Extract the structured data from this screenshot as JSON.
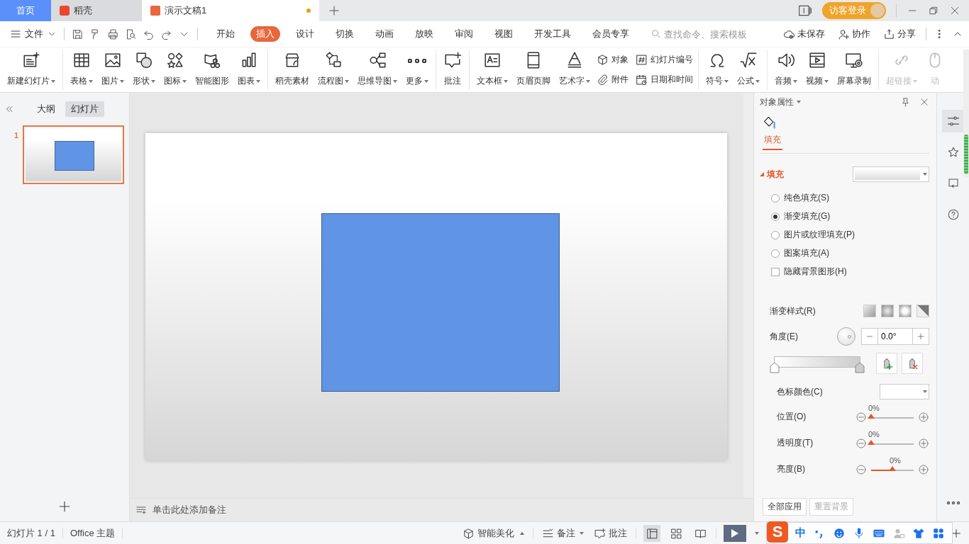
{
  "title_bar": {
    "tabs": [
      {
        "label": "首页",
        "kind": "home",
        "selected": false
      },
      {
        "label": "稻壳",
        "kind": "app",
        "selected": false
      },
      {
        "label": "演示文稿1",
        "kind": "doc",
        "selected": true,
        "unsaved": true
      }
    ],
    "login_button": "访客登录"
  },
  "menu_bar": {
    "file_menu": "文件",
    "tabs": [
      {
        "label": "开始",
        "selected": false
      },
      {
        "label": "插入",
        "selected": true
      },
      {
        "label": "设计",
        "selected": false
      },
      {
        "label": "切换",
        "selected": false
      },
      {
        "label": "动画",
        "selected": false
      },
      {
        "label": "放映",
        "selected": false
      },
      {
        "label": "审阅",
        "selected": false
      },
      {
        "label": "视图",
        "selected": false
      },
      {
        "label": "开发工具",
        "selected": false
      },
      {
        "label": "会员专享",
        "selected": false
      }
    ],
    "search": {
      "placeholder": "查找命令、搜索模板"
    },
    "actions": [
      "未保存",
      "协作",
      "分享"
    ]
  },
  "ribbon": {
    "groups": [
      [
        {
          "kind": "large",
          "label": "新建幻灯片",
          "dropdown": true,
          "disabled": false
        }
      ],
      [
        {
          "kind": "large",
          "label": "表格",
          "dropdown": true,
          "disabled": false
        },
        {
          "kind": "large",
          "label": "图片",
          "dropdown": true,
          "disabled": false
        },
        {
          "kind": "large",
          "label": "形状",
          "dropdown": true,
          "disabled": false
        },
        {
          "kind": "large",
          "label": "图标",
          "dropdown": true,
          "disabled": false
        },
        {
          "kind": "large",
          "label": "智能图形",
          "dropdown": false,
          "disabled": false
        },
        {
          "kind": "large",
          "label": "图表",
          "dropdown": true,
          "disabled": false
        }
      ],
      [
        {
          "kind": "large",
          "label": "稻壳素材",
          "dropdown": false,
          "disabled": false
        },
        {
          "kind": "large",
          "label": "流程图",
          "dropdown": true,
          "disabled": false
        },
        {
          "kind": "large",
          "label": "思维导图",
          "dropdown": true,
          "disabled": false
        },
        {
          "kind": "large",
          "label": "更多",
          "dropdown": true,
          "disabled": false
        }
      ],
      [
        {
          "kind": "large",
          "label": "批注",
          "dropdown": false,
          "disabled": false
        }
      ],
      [
        {
          "kind": "large",
          "label": "文本框",
          "dropdown": true,
          "disabled": false
        },
        {
          "kind": "large",
          "label": "页眉页脚",
          "dropdown": false,
          "disabled": false
        },
        {
          "kind": "large",
          "label": "艺术字",
          "dropdown": true,
          "disabled": false
        },
        {
          "kind": "small",
          "label": "对象",
          "dropdown": false,
          "disabled": false
        },
        {
          "kind": "small",
          "label": "附件",
          "dropdown": false,
          "disabled": false
        },
        {
          "kind": "small",
          "label": "幻灯片编号",
          "dropdown": false,
          "disabled": false
        },
        {
          "kind": "small",
          "label": "日期和时间",
          "dropdown": false,
          "disabled": false
        }
      ],
      [
        {
          "kind": "large",
          "label": "符号",
          "dropdown": true,
          "disabled": false
        },
        {
          "kind": "large",
          "label": "公式",
          "dropdown": true,
          "disabled": false
        }
      ],
      [
        {
          "kind": "large",
          "label": "音频",
          "dropdown": true,
          "disabled": false
        },
        {
          "kind": "large",
          "label": "视频",
          "dropdown": true,
          "disabled": false
        },
        {
          "kind": "large",
          "label": "屏幕录制",
          "dropdown": false,
          "disabled": false
        }
      ],
      [
        {
          "kind": "large",
          "label": "超链接",
          "dropdown": true,
          "disabled": true
        },
        {
          "kind": "large",
          "label": "动",
          "dropdown": false,
          "disabled": true
        }
      ]
    ]
  },
  "slide_panel": {
    "tabs": [
      {
        "label": "大纲",
        "selected": false
      },
      {
        "label": "幻灯片",
        "selected": true
      }
    ],
    "slides": [
      {
        "number": "1",
        "selected": true
      }
    ]
  },
  "slide": {
    "shapes": [
      {
        "kind": "rectangle"
      }
    ]
  },
  "notes": {
    "placeholder": "单击此处添加备注"
  },
  "properties_panel": {
    "title": "对象属性",
    "tabs": [
      {
        "label": "填充",
        "selected": true
      }
    ],
    "section": "填充",
    "fill_options": [
      {
        "kind": "radio",
        "label": "纯色填充(S)",
        "selected": false
      },
      {
        "kind": "radio",
        "label": "渐变填充(G)",
        "selected": true
      },
      {
        "kind": "radio",
        "label": "图片或纹理填充(P)",
        "selected": false
      },
      {
        "kind": "radio",
        "label": "图案填充(A)",
        "selected": false
      },
      {
        "kind": "checkbox",
        "label": "隐藏背景图形(H)",
        "checked": false
      }
    ],
    "gradient_style_label": "渐变样式(R)",
    "angle": {
      "label": "角度(E)",
      "value": "0.0°"
    },
    "stop_color_label": "色标颜色(C)",
    "sliders": [
      {
        "label": "位置(O)",
        "reading": "0%",
        "level": 0
      },
      {
        "label": "透明度(T)",
        "reading": "0%",
        "level": 0
      },
      {
        "label": "亮度(B)",
        "reading": "0%",
        "level": 0.5
      }
    ],
    "buttons": [
      {
        "label": "全部应用",
        "disabled": false
      },
      {
        "label": "重置背景",
        "disabled": true
      }
    ]
  },
  "status_bar": {
    "slide_count": "幻灯片 1 / 1",
    "theme": "Office 主题",
    "beautify": "智能美化",
    "notes": "备注",
    "comments": "批注",
    "views": [
      {
        "kind": "normal",
        "selected": true
      },
      {
        "kind": "sorter",
        "selected": false
      },
      {
        "kind": "reading",
        "selected": false
      }
    ]
  },
  "ime_bar": {
    "logo": "S",
    "mode": "中"
  }
}
